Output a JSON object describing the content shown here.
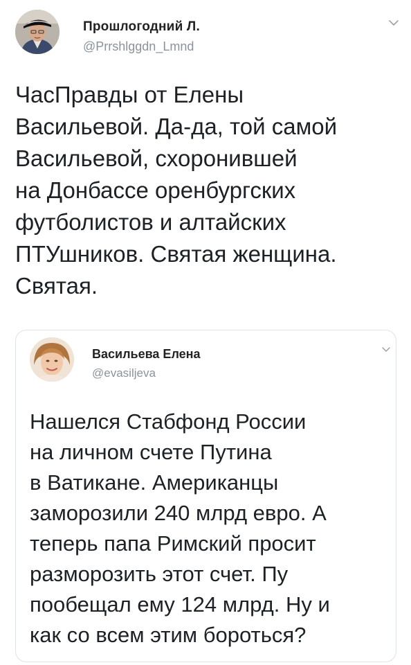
{
  "tweet": {
    "author_name": "Прошлогодний Л.",
    "author_handle": "@Prrshlggdn_Lmnd",
    "text": "ЧасПравды от Елены\nВасильевой. Да-да, той самой\nВасильевой, схоронившей\nна Донбассе оренбургских\nфутболистов и алтайских\nПТУшников. Святая женщина.\nСвятая."
  },
  "quoted_tweet": {
    "author_name": "Васильева Елена",
    "author_handle": "@evasiljeva",
    "text": "Нашелся Стабфонд России\nна личном счете Путина\nв Ватикане. Американцы\nзаморозили 240 млрд евро. А\nтеперь папа Римский просит\nразморозить этот счет. Пу\nпообещал ему 124 млрд.  Ну и\nкак со всем этим бороться?"
  },
  "icons": {
    "menu": "chevron-down-icon",
    "avatar_main": "man-in-cap-avatar",
    "avatar_quote": "woman-avatar"
  },
  "colors": {
    "text": "#1c2126",
    "secondary_text": "#8a939b",
    "border": "#dfe3e6",
    "background": "#ffffff"
  }
}
